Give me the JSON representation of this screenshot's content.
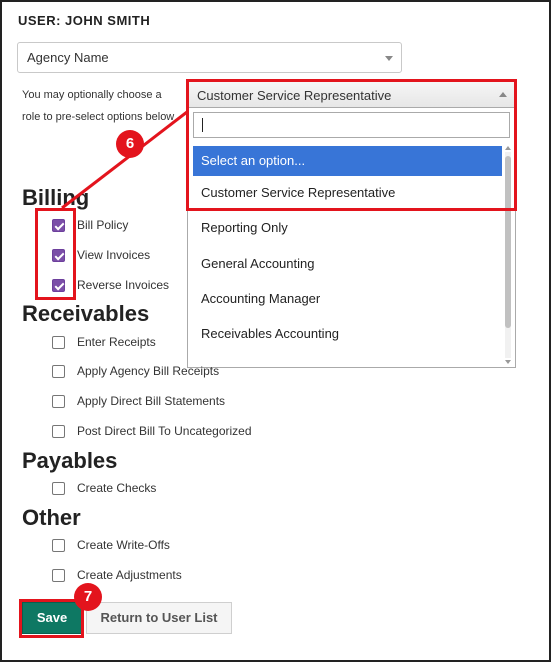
{
  "user_title": "USER: JOHN SMITH",
  "agency_select": {
    "value": "Agency Name"
  },
  "hint_lines": [
    "You may optionally choose a",
    "role to pre-select options below"
  ],
  "role_select": {
    "value": "Customer Service Representative",
    "options": [
      {
        "label": "Select an option...",
        "highlighted": true
      },
      {
        "label": "Customer Service Representative",
        "highlighted": false
      },
      {
        "label": "Reporting Only",
        "highlighted": false
      },
      {
        "label": "General Accounting",
        "highlighted": false
      },
      {
        "label": "Accounting Manager",
        "highlighted": false
      },
      {
        "label": "Receivables Accounting",
        "highlighted": false
      }
    ]
  },
  "sections": [
    {
      "heading": "Billing",
      "items": [
        {
          "label": "Bill Policy",
          "checked": true
        },
        {
          "label": "View Invoices",
          "checked": true
        },
        {
          "label": "Reverse Invoices",
          "checked": true
        }
      ]
    },
    {
      "heading": "Receivables",
      "items": [
        {
          "label": "Enter Receipts",
          "checked": false
        },
        {
          "label": "Apply Agency Bill Receipts",
          "checked": false
        },
        {
          "label": "Apply Direct Bill Statements",
          "checked": false
        },
        {
          "label": "Post Direct Bill To Uncategorized",
          "checked": false
        }
      ]
    },
    {
      "heading": "Payables",
      "items": [
        {
          "label": "Create Checks",
          "checked": false
        }
      ]
    },
    {
      "heading": "Other",
      "items": [
        {
          "label": "Create Write-Offs",
          "checked": false
        },
        {
          "label": "Create Adjustments",
          "checked": false
        }
      ]
    }
  ],
  "buttons": {
    "save": "Save",
    "return": "Return to User List"
  },
  "annotations": {
    "step6": "6",
    "step7": "7",
    "color": "#e3141d"
  },
  "colors": {
    "save_button": "#0e7863",
    "highlight": "#3875d7",
    "checkbox_checked": "#7b4fa8"
  }
}
